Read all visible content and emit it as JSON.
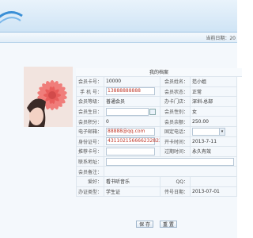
{
  "header": {
    "date_label": "当前日期：20"
  },
  "profile": {
    "title": "我的档案",
    "rows": [
      {
        "l1": "会员卡号：",
        "v1": "10000",
        "l2": "会员姓名：",
        "v2": "范小姐"
      },
      {
        "l1": "手 机 号：",
        "v1": "13888888888",
        "l2": "会员状态：",
        "v2": "正常"
      },
      {
        "l1": "会员等级：",
        "v1": "普通会员",
        "l2": "办卡门店：",
        "v2": "深圳-总部"
      },
      {
        "l1": "会员生日：",
        "v1": "",
        "l2": "会员性别：",
        "v2": "女"
      },
      {
        "l1": "会员积分：",
        "v1": "0",
        "l2": "会员余额：",
        "v2": "250.00"
      },
      {
        "l1": "电子邮箱：",
        "v1": "88888@qq.com",
        "l2": "固定电话：",
        "v2": ""
      },
      {
        "l1": "身份证号：",
        "v1": "431102156666232823",
        "l2": "开卡时间：",
        "v2": "2013-7-11"
      },
      {
        "l1": "推荐卡号：",
        "v1": "",
        "l2": "过期时间：",
        "v2": "永久有效"
      }
    ],
    "address_label": "联系地址：",
    "note_label": "会员备注：",
    "hobby_label": "爱好：",
    "hobby_value": "看书听音乐",
    "qq_label": "QQ：",
    "qq_value": "",
    "cert_type_label": "办证类型：",
    "cert_type_value": "学生证",
    "fax_label": "传号日期：",
    "fax_value": "2013-07-01"
  },
  "buttons": {
    "save": "保 存",
    "reset": "重 置"
  }
}
